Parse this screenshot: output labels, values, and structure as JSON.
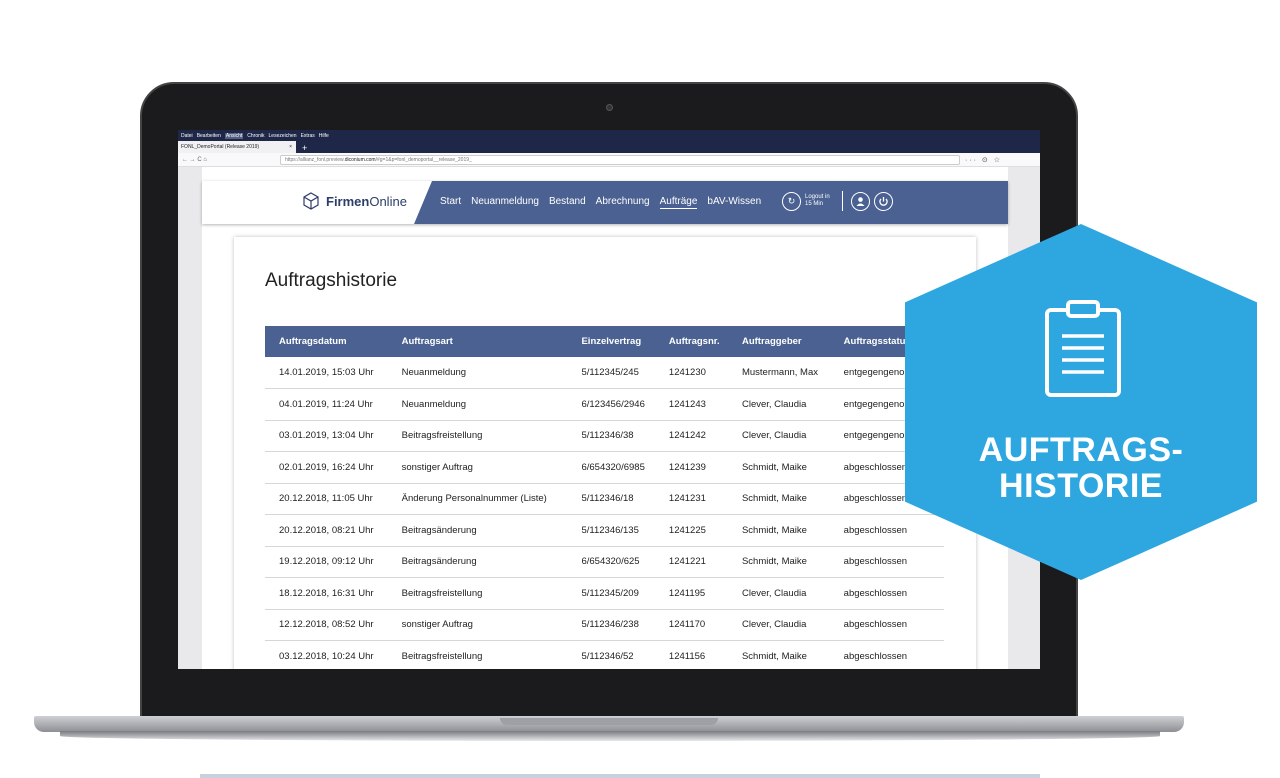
{
  "browser": {
    "menu": [
      "Datei",
      "Bearbeiten",
      "Ansicht",
      "Chronik",
      "Lesezeichen",
      "Extras",
      "Hilfe"
    ],
    "active_menu_index": 2,
    "tab_title": "FONL_DemoPortal (Release 2019)",
    "tab_close": "×",
    "new_tab": "+",
    "url_prefix": "https://allianz_fonl.preview.",
    "url_host": "diconium.com",
    "url_suffix": "/#g=1&p=fonl_demoportal__release_2019_",
    "nav_glyphs": "← → C ⌂",
    "right_glyphs": "··· ⊙ ☆"
  },
  "app": {
    "logo_strong": "Firmen",
    "logo_light": "Online",
    "nav": [
      "Start",
      "Neuanmeldung",
      "Bestand",
      "Abrechnung",
      "Aufträge",
      "bAV-Wissen"
    ],
    "active_nav_index": 4,
    "logout_line1": "Logout in",
    "logout_line2": "15 Min"
  },
  "main": {
    "title": "Auftragshistorie",
    "columns": [
      "Auftragsdatum",
      "Auftragsart",
      "Einzelvertrag",
      "Auftragsnr.",
      "Auftraggeber",
      "Auftragsstatus"
    ],
    "rows": [
      [
        "14.01.2019, 15:03 Uhr",
        "Neuanmeldung",
        "5/112345/245",
        "1241230",
        "Mustermann, Max",
        "entgegengenommen"
      ],
      [
        "04.01.2019, 11:24 Uhr",
        "Neuanmeldung",
        "6/123456/2946",
        "1241243",
        "Clever, Claudia",
        "entgegengenommen"
      ],
      [
        "03.01.2019, 13:04 Uhr",
        "Beitragsfreistellung",
        "5/112346/38",
        "1241242",
        "Clever, Claudia",
        "entgegengenommen"
      ],
      [
        "02.01.2019, 16:24 Uhr",
        "sonstiger Auftrag",
        "6/654320/6985",
        "1241239",
        "Schmidt, Maike",
        "abgeschlossen"
      ],
      [
        "20.12.2018, 11:05 Uhr",
        "Änderung Personalnummer (Liste)",
        "5/112346/18",
        "1241231",
        "Schmidt, Maike",
        "abgeschlossen"
      ],
      [
        "20.12.2018, 08:21 Uhr",
        "Beitragsänderung",
        "5/112346/135",
        "1241225",
        "Schmidt, Maike",
        "abgeschlossen"
      ],
      [
        "19.12.2018, 09:12 Uhr",
        "Beitragsänderung",
        "6/654320/625",
        "1241221",
        "Schmidt, Maike",
        "abgeschlossen"
      ],
      [
        "18.12.2018, 16:31 Uhr",
        "Beitragsfreistellung",
        "5/112345/209",
        "1241195",
        "Clever, Claudia",
        "abgeschlossen"
      ],
      [
        "12.12.2018, 08:52 Uhr",
        "sonstiger Auftrag",
        "5/112346/238",
        "1241170",
        "Clever, Claudia",
        "abgeschlossen"
      ],
      [
        "03.12.2018, 10:24 Uhr",
        "Beitragsfreistellung",
        "5/112346/52",
        "1241156",
        "Schmidt, Maike",
        "abgeschlossen"
      ]
    ]
  },
  "badge": {
    "line1": "AUFTRAGS-",
    "line2": "HISTORIE",
    "icon": "clipboard-icon",
    "color": "#2ea7e0"
  },
  "colors": {
    "nav_blue": "#4b6191",
    "browser_dark": "#1e2747"
  }
}
